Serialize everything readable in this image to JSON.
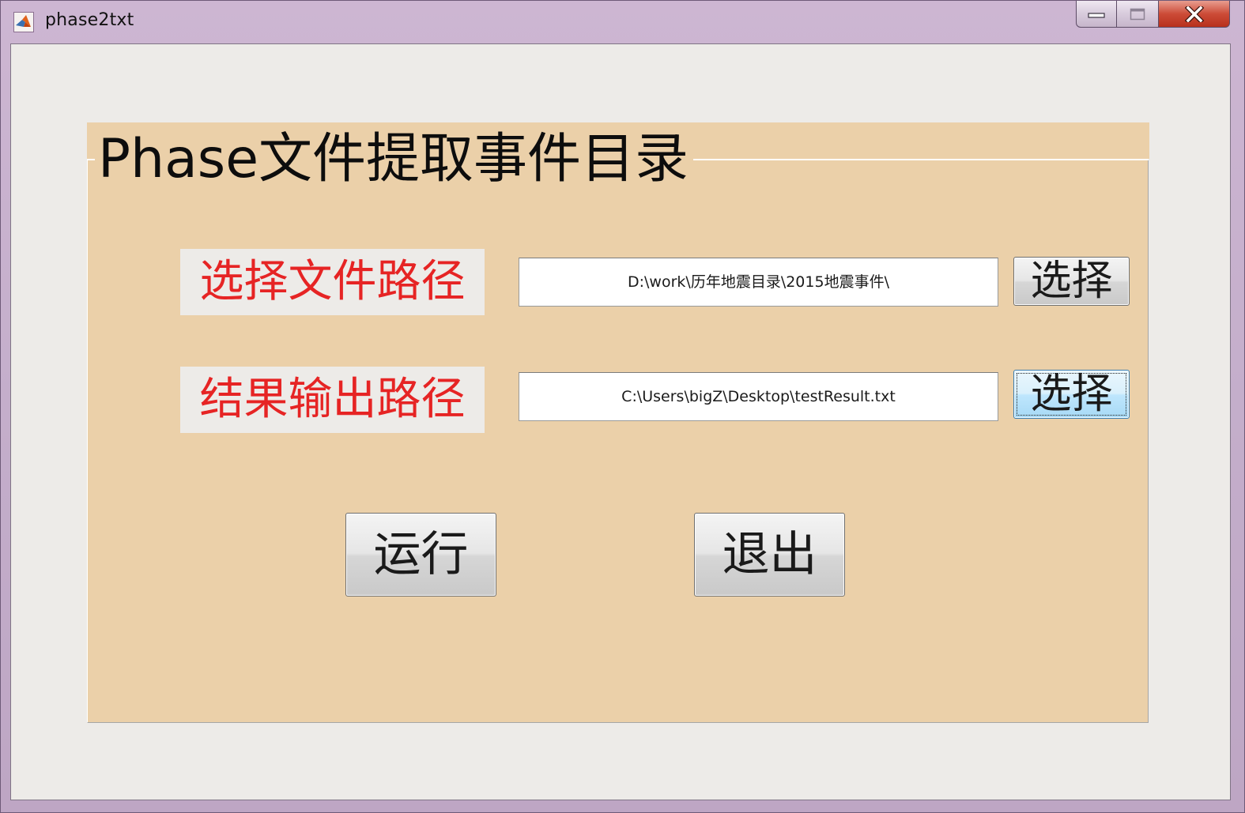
{
  "window": {
    "title": "phase2txt",
    "icon": "matlab-icon",
    "controls": {
      "minimize": "minimize-icon",
      "maximize": "maximize-icon",
      "close": "close-icon"
    }
  },
  "panel": {
    "title": "Phase文件提取事件目录",
    "background": "#ebd0a9"
  },
  "fields": [
    {
      "label": "选择文件路径",
      "value": "D:\\work\\历年地震目录\\2015地震事件\\",
      "button_label": "选择"
    },
    {
      "label": "结果输出路径",
      "value": "C:\\Users\\bigZ\\Desktop\\testResult.txt",
      "button_label": "选择"
    }
  ],
  "actions": {
    "run_label": "运行",
    "exit_label": "退出"
  },
  "colors": {
    "label_text": "#e62424",
    "focused_button": "#bee6fd"
  }
}
